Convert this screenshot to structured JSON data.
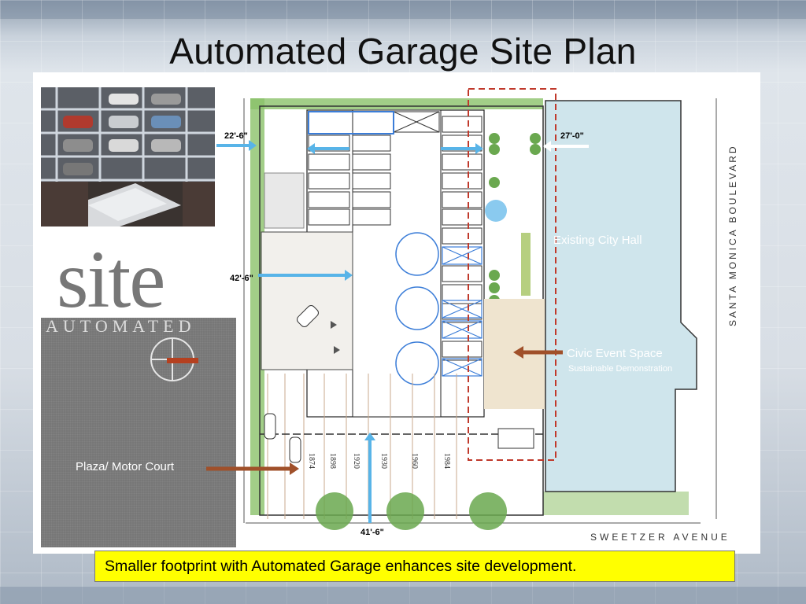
{
  "slide": {
    "title": "Automated Garage Site Plan",
    "caption": "Smaller footprint with Automated Garage enhances site development."
  },
  "logo": {
    "word": "site",
    "subword": "AUTOMATED"
  },
  "plan": {
    "dimensions": {
      "top_left": "22'-6\"",
      "middle_left": "42'-6\"",
      "top_right": "27'-0\"",
      "bottom": "41'-6\""
    },
    "labels": {
      "city_hall": "Existing City Hall",
      "civic_event": "Civic Event Space",
      "sustainable": "Sustainable Demonstration",
      "plaza": "Plaza/ Motor Court"
    },
    "streets": {
      "east": "SANTA MONICA BOULEVARD",
      "south": "SWEETZER AVENUE"
    },
    "lot_numbers": [
      "1874",
      "1898",
      "1920",
      "1930",
      "1960",
      "1984"
    ]
  },
  "colors": {
    "accent_arrow": "#58b4e8",
    "brown_arrow": "#a0502a",
    "city_hall_fill": "#cfe5ec",
    "caption_bg": "#ffff00",
    "green": "#6aa84f"
  }
}
